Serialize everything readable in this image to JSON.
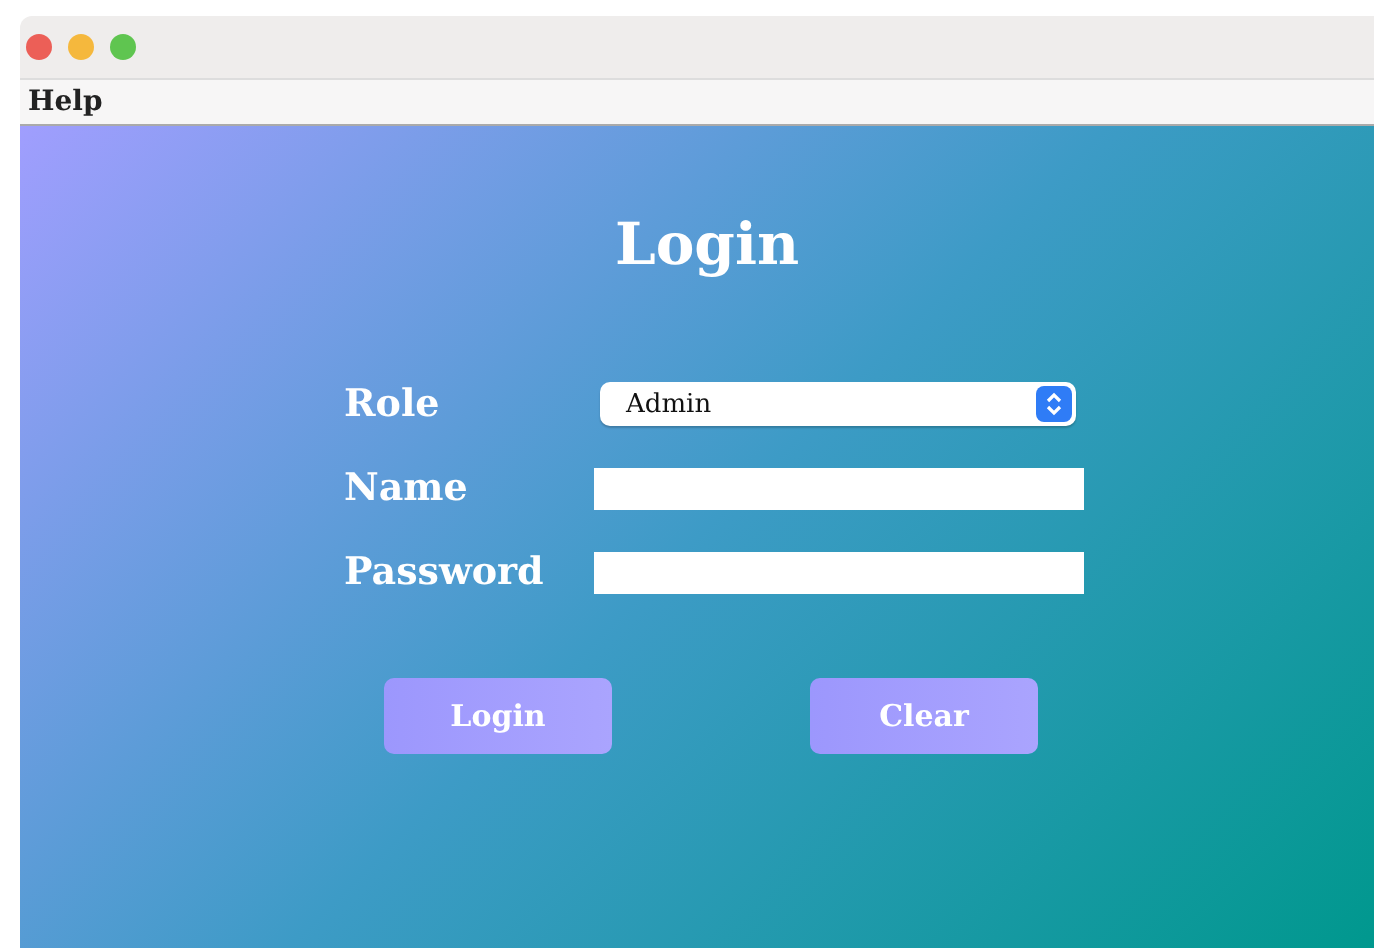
{
  "menu": [
    "Help"
  ],
  "title": "Login",
  "fields": [
    {
      "kind": "select",
      "label": "Role",
      "value": "Admin"
    },
    {
      "kind": "text",
      "label": "Name"
    },
    {
      "kind": "password",
      "label": "Password"
    }
  ],
  "buttons": [
    "Login",
    "Clear"
  ]
}
